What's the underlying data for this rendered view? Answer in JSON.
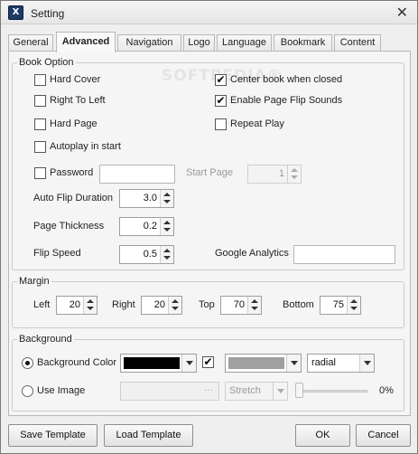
{
  "window": {
    "title": "Setting",
    "app_icon_glyph": "X",
    "close_glyph": "✕"
  },
  "tabs": [
    {
      "label": "General",
      "active": false
    },
    {
      "label": "Advanced",
      "active": true
    },
    {
      "label": "Navigation",
      "active": false
    },
    {
      "label": "Logo",
      "active": false
    },
    {
      "label": "Language",
      "active": false
    },
    {
      "label": "Bookmark",
      "active": false
    },
    {
      "label": "Content",
      "active": false
    }
  ],
  "watermark": "SOFTPEDIA®",
  "book_option": {
    "label": "Book Option",
    "hard_cover": {
      "label": "Hard Cover",
      "checked": false
    },
    "right_to_left": {
      "label": "Right To Left",
      "checked": false
    },
    "hard_page": {
      "label": "Hard Page",
      "checked": false
    },
    "autoplay": {
      "label": "Autoplay in start",
      "checked": false
    },
    "password": {
      "label": "Password",
      "checked": false,
      "value": ""
    },
    "center_book": {
      "label": "Center book when closed",
      "checked": true
    },
    "flip_sounds": {
      "label": "Enable Page Flip Sounds",
      "checked": true
    },
    "repeat_play": {
      "label": "Repeat Play",
      "checked": false
    },
    "start_page": {
      "label": "Start Page",
      "value": "1"
    },
    "auto_flip_duration": {
      "label": "Auto Flip Duration",
      "value": "3.0"
    },
    "page_thickness": {
      "label": "Page Thickness",
      "value": "0.2"
    },
    "flip_speed": {
      "label": "Flip Speed",
      "value": "0.5"
    },
    "google_analytics": {
      "label": "Google Analytics",
      "value": ""
    }
  },
  "margin": {
    "label": "Margin",
    "left": {
      "label": "Left",
      "value": "20"
    },
    "right": {
      "label": "Right",
      "value": "20"
    },
    "top": {
      "label": "Top",
      "value": "70"
    },
    "bottom": {
      "label": "Bottom",
      "value": "75"
    }
  },
  "background": {
    "label": "Background",
    "color_option": {
      "label": "Background Color",
      "selected": true
    },
    "color1": "#000000",
    "color2_enabled": true,
    "color2": "#a0a0a0",
    "gradient_type": "radial",
    "image_option": {
      "label": "Use Image",
      "selected": false
    },
    "image_path": "",
    "browse_glyph": "···",
    "image_mode": "Stretch",
    "opacity_fraction": 0,
    "opacity_text": "0%"
  },
  "buttons": {
    "save_template": "Save Template",
    "load_template": "Load Template",
    "ok": "OK",
    "cancel": "Cancel"
  },
  "colors": {
    "window_bg": "#efefef",
    "panel_bg": "#f5f5f5",
    "accent_dark": "#1d3a66"
  }
}
